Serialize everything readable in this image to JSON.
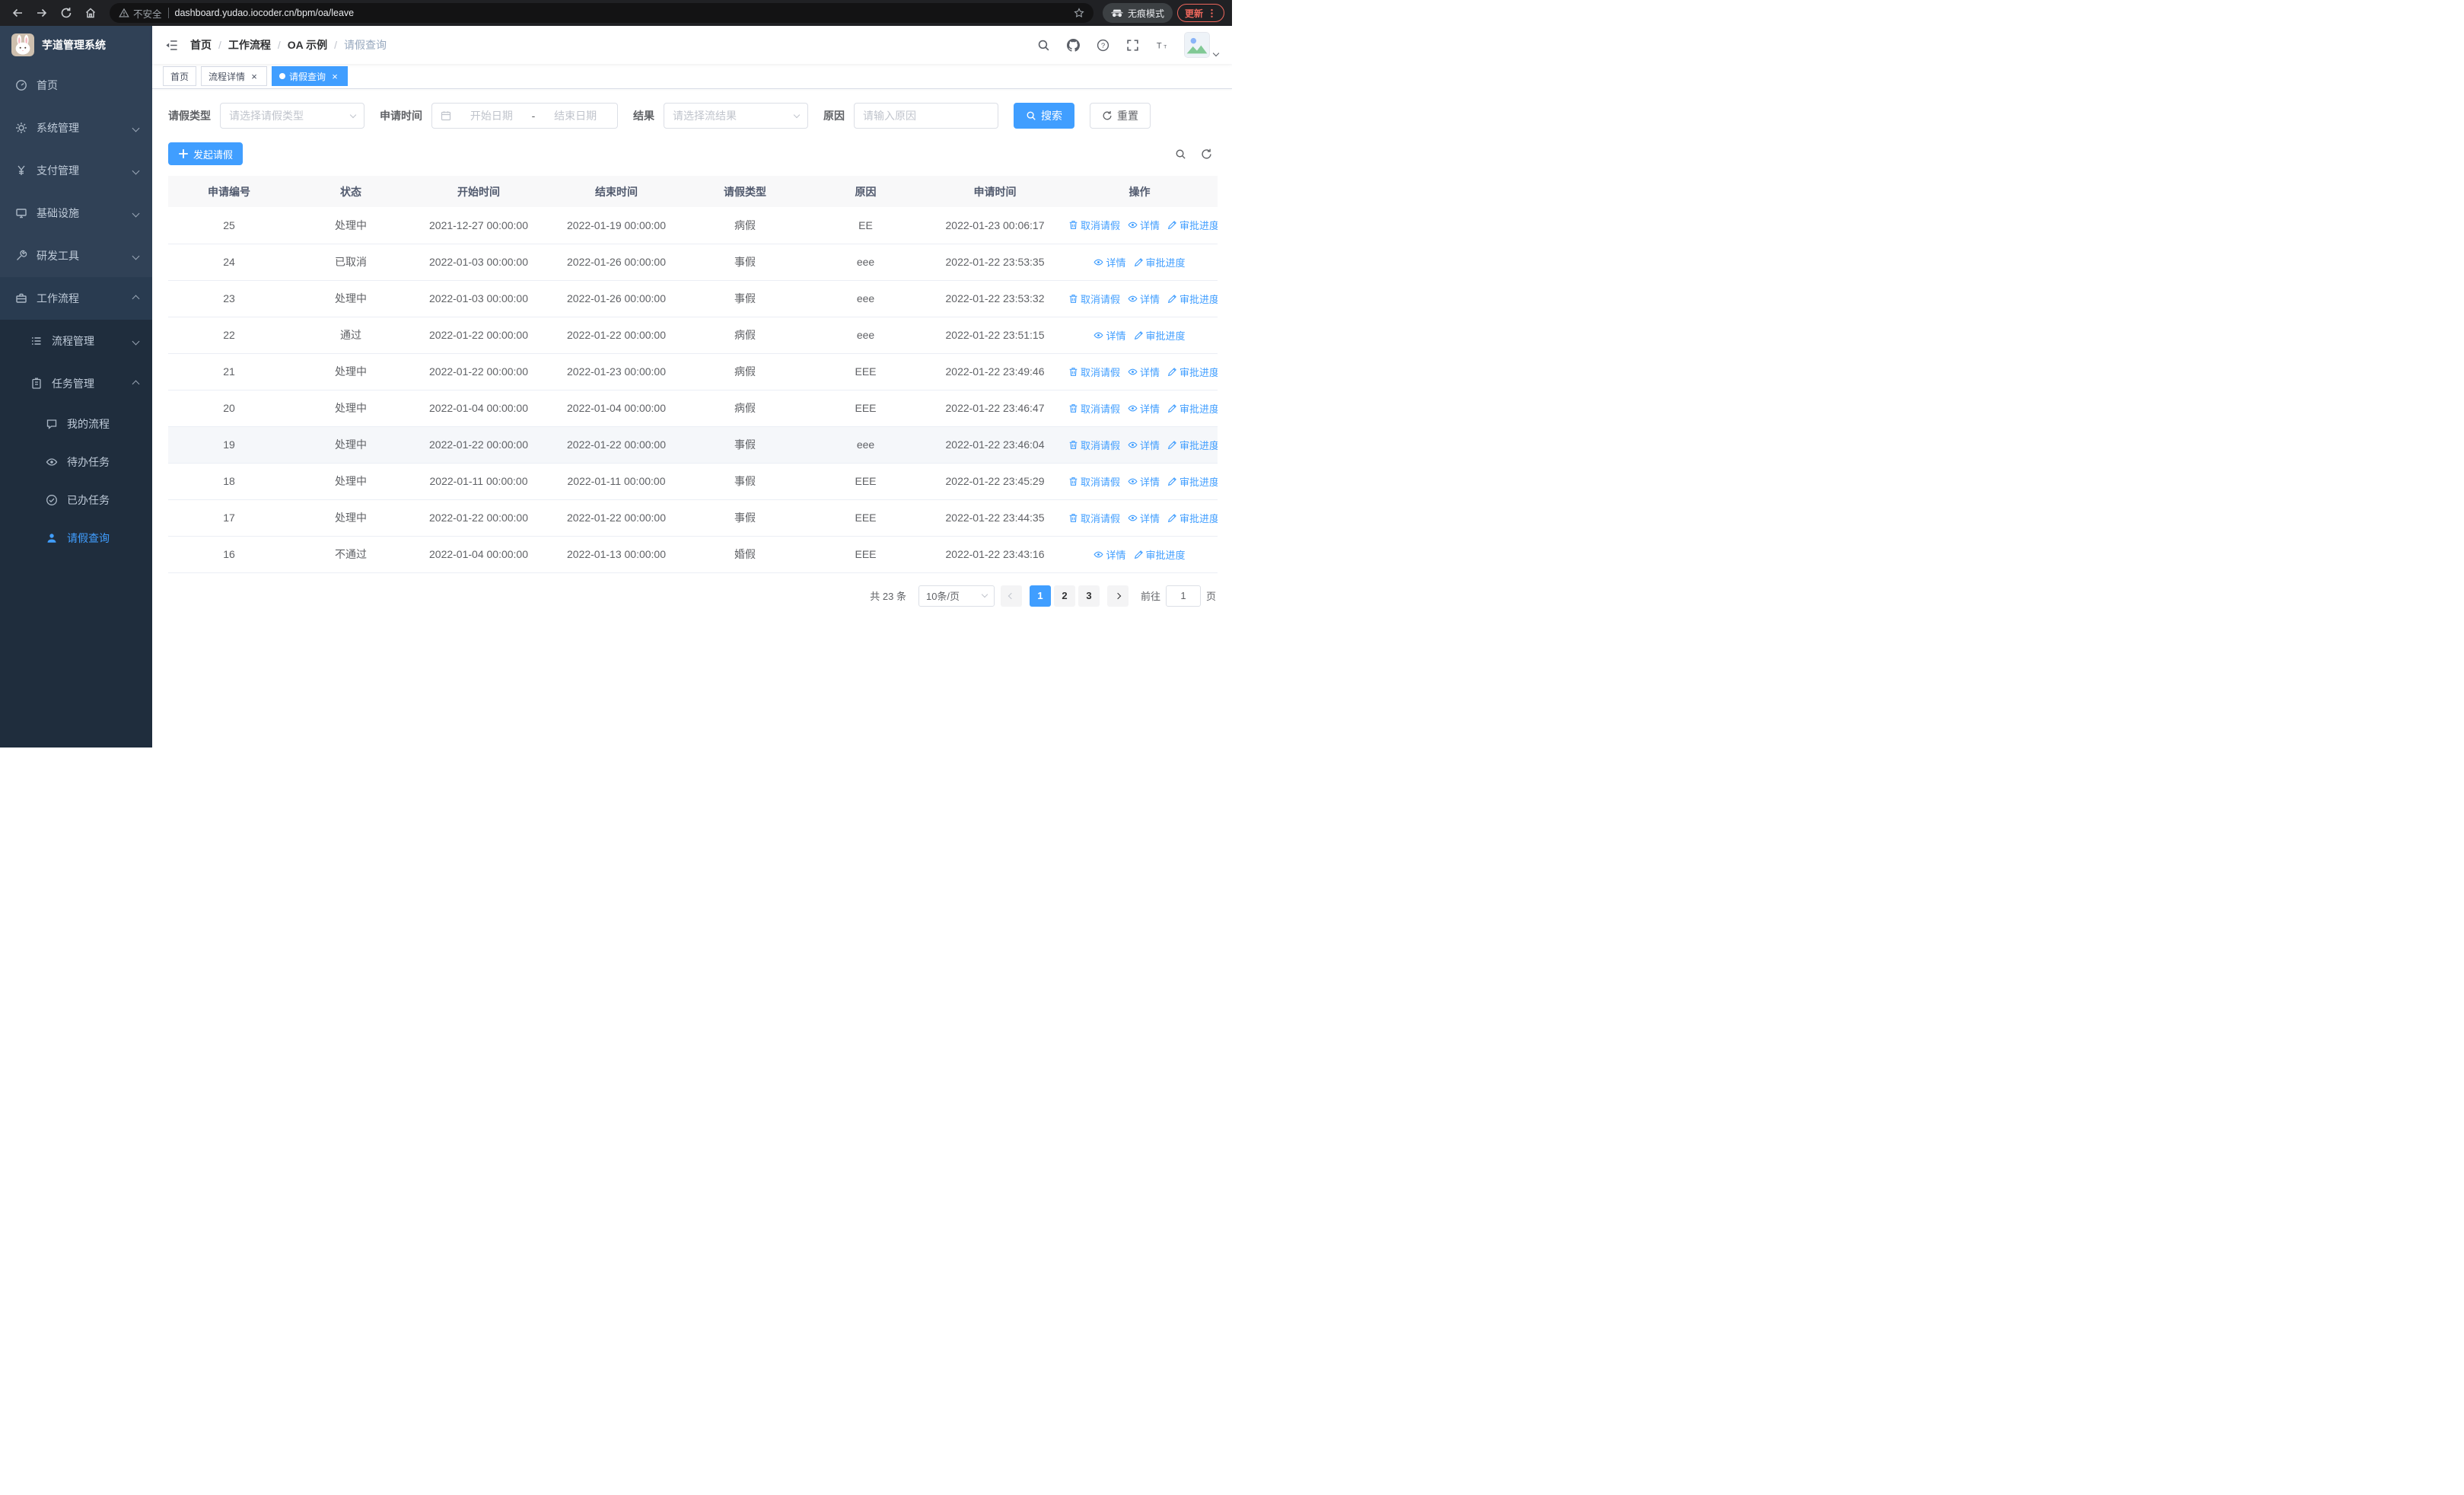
{
  "browser": {
    "security_label": "不安全",
    "url": "dashboard.yudao.iocoder.cn/bpm/oa/leave",
    "incognito_label": "无痕模式",
    "update_label": "更新"
  },
  "sidebar": {
    "logo_title": "芋道管理系统",
    "menu": {
      "home": "首页",
      "system": "系统管理",
      "payment": "支付管理",
      "infra": "基础设施",
      "devtools": "研发工具",
      "workflow": "工作流程",
      "process_mgmt": "流程管理",
      "task_mgmt": "任务管理",
      "my_process": "我的流程",
      "todo_tasks": "待办任务",
      "done_tasks": "已办任务",
      "leave_query": "请假查询"
    }
  },
  "header": {
    "breadcrumb": [
      "首页",
      "工作流程",
      "OA 示例",
      "请假查询"
    ]
  },
  "tabs": [
    {
      "label": "首页"
    },
    {
      "label": "流程详情"
    },
    {
      "label": "请假查询"
    }
  ],
  "filters": {
    "leave_type_label": "请假类型",
    "leave_type_placeholder": "请选择请假类型",
    "apply_time_label": "申请时间",
    "start_date_placeholder": "开始日期",
    "date_separator": "-",
    "end_date_placeholder": "结束日期",
    "result_label": "结果",
    "result_placeholder": "请选择流结果",
    "reason_label": "原因",
    "reason_placeholder": "请输入原因",
    "search_label": "搜索",
    "reset_label": "重置"
  },
  "toolbar": {
    "create_label": "发起请假"
  },
  "table": {
    "columns": [
      "申请编号",
      "状态",
      "开始时间",
      "结束时间",
      "请假类型",
      "原因",
      "申请时间",
      "操作"
    ],
    "action_labels": {
      "cancel": "取消请假",
      "detail": "详情",
      "progress": "审批进度"
    },
    "rows": [
      {
        "id": "25",
        "status": "处理中",
        "start": "2021-12-27 00:00:00",
        "end": "2022-01-19 00:00:00",
        "type": "病假",
        "reason": "EE",
        "applied": "2022-01-23 00:06:17",
        "actions": [
          "cancel",
          "detail",
          "progress"
        ],
        "highlight": false
      },
      {
        "id": "24",
        "status": "已取消",
        "start": "2022-01-03 00:00:00",
        "end": "2022-01-26 00:00:00",
        "type": "事假",
        "reason": "eee",
        "applied": "2022-01-22 23:53:35",
        "actions": [
          "detail",
          "progress"
        ],
        "highlight": false
      },
      {
        "id": "23",
        "status": "处理中",
        "start": "2022-01-03 00:00:00",
        "end": "2022-01-26 00:00:00",
        "type": "事假",
        "reason": "eee",
        "applied": "2022-01-22 23:53:32",
        "actions": [
          "cancel",
          "detail",
          "progress"
        ],
        "highlight": false
      },
      {
        "id": "22",
        "status": "通过",
        "start": "2022-01-22 00:00:00",
        "end": "2022-01-22 00:00:00",
        "type": "病假",
        "reason": "eee",
        "applied": "2022-01-22 23:51:15",
        "actions": [
          "detail",
          "progress"
        ],
        "highlight": false
      },
      {
        "id": "21",
        "status": "处理中",
        "start": "2022-01-22 00:00:00",
        "end": "2022-01-23 00:00:00",
        "type": "病假",
        "reason": "EEE",
        "applied": "2022-01-22 23:49:46",
        "actions": [
          "cancel",
          "detail",
          "progress"
        ],
        "highlight": false
      },
      {
        "id": "20",
        "status": "处理中",
        "start": "2022-01-04 00:00:00",
        "end": "2022-01-04 00:00:00",
        "type": "病假",
        "reason": "EEE",
        "applied": "2022-01-22 23:46:47",
        "actions": [
          "cancel",
          "detail",
          "progress"
        ],
        "highlight": false
      },
      {
        "id": "19",
        "status": "处理中",
        "start": "2022-01-22 00:00:00",
        "end": "2022-01-22 00:00:00",
        "type": "事假",
        "reason": "eee",
        "applied": "2022-01-22 23:46:04",
        "actions": [
          "cancel",
          "detail",
          "progress"
        ],
        "highlight": true
      },
      {
        "id": "18",
        "status": "处理中",
        "start": "2022-01-11 00:00:00",
        "end": "2022-01-11 00:00:00",
        "type": "事假",
        "reason": "EEE",
        "applied": "2022-01-22 23:45:29",
        "actions": [
          "cancel",
          "detail",
          "progress"
        ],
        "highlight": false
      },
      {
        "id": "17",
        "status": "处理中",
        "start": "2022-01-22 00:00:00",
        "end": "2022-01-22 00:00:00",
        "type": "事假",
        "reason": "EEE",
        "applied": "2022-01-22 23:44:35",
        "actions": [
          "cancel",
          "detail",
          "progress"
        ],
        "highlight": false
      },
      {
        "id": "16",
        "status": "不通过",
        "start": "2022-01-04 00:00:00",
        "end": "2022-01-13 00:00:00",
        "type": "婚假",
        "reason": "EEE",
        "applied": "2022-01-22 23:43:16",
        "actions": [
          "detail",
          "progress"
        ],
        "highlight": false
      }
    ]
  },
  "pagination": {
    "total_label": "共 23 条",
    "page_size_label": "10条/页",
    "pages": [
      "1",
      "2",
      "3"
    ],
    "active_page": "1",
    "goto_label": "前往",
    "goto_value": "1",
    "page_unit_label": "页"
  }
}
